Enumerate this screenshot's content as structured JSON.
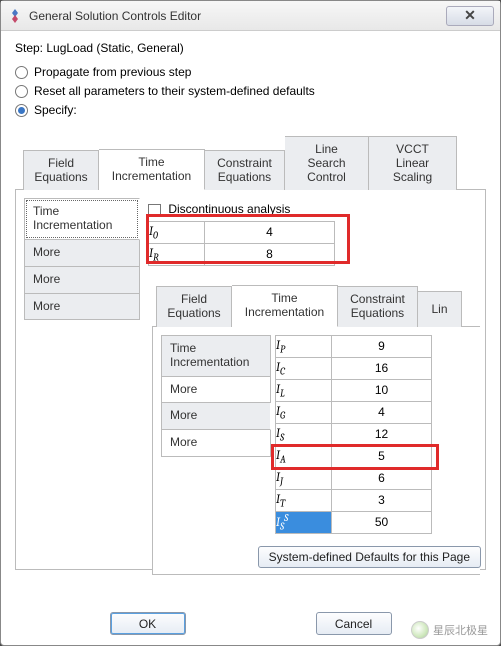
{
  "window": {
    "title": "General Solution Controls Editor"
  },
  "step": {
    "label": "Step:",
    "value": "LugLoad (Static, General)"
  },
  "radios": {
    "propagate": "Propagate from previous step",
    "reset": "Reset all parameters to their system-defined defaults",
    "specify": "Specify:"
  },
  "tabs_main": {
    "field_eq": "Field\nEquations",
    "time_inc": "Time\nIncrementation",
    "constraint_eq": "Constraint\nEquations",
    "line_search": "Line Search\nControl",
    "vcct": "VCCT Linear\nScaling"
  },
  "vtabs_left": {
    "time_inc": "Time\nIncrementation",
    "more1": "More",
    "more2": "More",
    "more3": "More"
  },
  "disc_analysis": "Discontinuous analysis",
  "params_top": [
    {
      "name_html": "I<sub>0</sub>",
      "value": "4"
    },
    {
      "name_html": "I<sub>R</sub>",
      "value": "8"
    }
  ],
  "tabs_inner": {
    "field_eq": "Field\nEquations",
    "time_inc": "Time\nIncrementation",
    "constraint_eq": "Constraint\nEquations",
    "lin_partial": "Lin"
  },
  "vtabs_inner": {
    "time_inc": "Time\nIncrementation",
    "more1": "More",
    "more2": "More",
    "more3": "More"
  },
  "params_inner": [
    {
      "name_html": "I<sub>P</sub>",
      "value": "9"
    },
    {
      "name_html": "I<sub>C</sub>",
      "value": "16"
    },
    {
      "name_html": "I<sub>L</sub>",
      "value": "10"
    },
    {
      "name_html": "I<sub>G</sub>",
      "value": "4"
    },
    {
      "name_html": "I<sub>S</sub>",
      "value": "12"
    },
    {
      "name_html": "I<sub>A</sub>",
      "value": "5"
    },
    {
      "name_html": "I<sub>J</sub>",
      "value": "6"
    },
    {
      "name_html": "I<sub>T</sub>",
      "value": "3"
    },
    {
      "name_html": "I<sub>S</sub><sup>S</sup>",
      "value": "50"
    }
  ],
  "sys_defaults_btn": "System-defined Defaults for this Page",
  "buttons": {
    "ok": "OK",
    "cancel": "Cancel"
  },
  "watermark": "星辰北极星"
}
